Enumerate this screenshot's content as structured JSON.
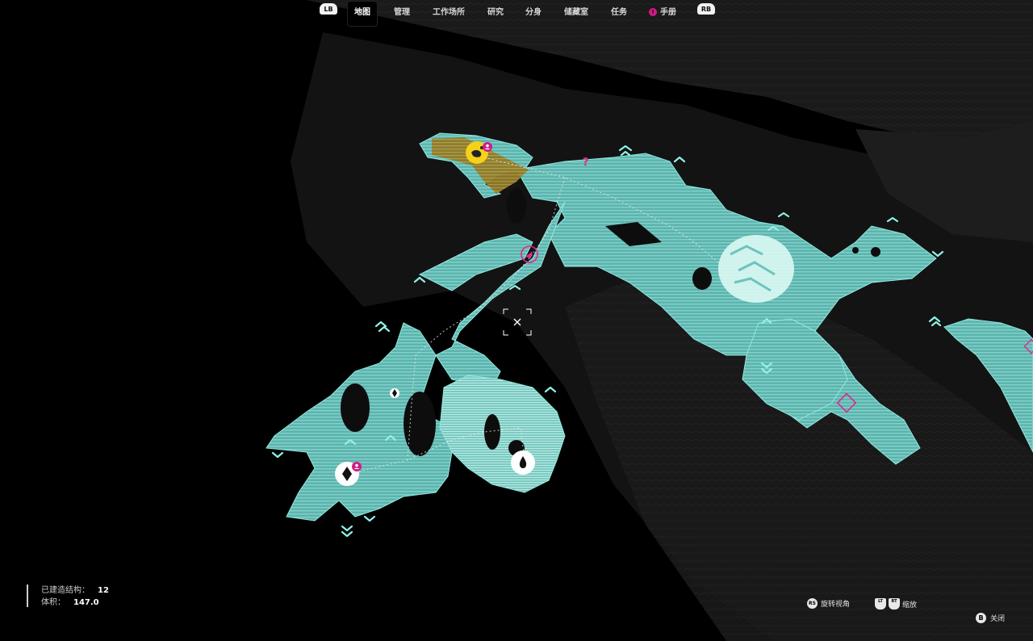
{
  "nav": {
    "left_button": "LB",
    "right_button": "RB",
    "tabs": [
      {
        "label": "地图",
        "active": true
      },
      {
        "label": "管理",
        "active": false
      },
      {
        "label": "工作场所",
        "active": false
      },
      {
        "label": "研究",
        "active": false
      },
      {
        "label": "分身",
        "active": false
      },
      {
        "label": "储藏室",
        "active": false
      },
      {
        "label": "任务",
        "active": false
      },
      {
        "label": "手册",
        "active": false
      }
    ],
    "handbook_badge": "!"
  },
  "stats": {
    "structures_label": "已建造结构：",
    "structures_value": "12",
    "volume_label": "体积：",
    "volume_value": "147.0"
  },
  "controls": {
    "rotate_button": "RS",
    "rotate_label": "旋转视角",
    "zoom_button_left": "LT",
    "zoom_button_right": "RT",
    "zoom_label": "缩放",
    "close_button": "B",
    "close_label": "关闭"
  },
  "map": {
    "colors": {
      "region": "#6fc3bd",
      "region_dark": "#3f8883",
      "highlight_zone": "#b69b3a",
      "player_marker": "#f5d11a",
      "poi_magenta": "#e0278f",
      "chevron": "#8ff3e8",
      "base_circle": "#d9f7f2"
    },
    "icons": [
      "player-marker-icon",
      "question-mark-icon",
      "target-marker-icon",
      "water-drop-icon",
      "resource-diamond-icon",
      "crosshair-icon",
      "base-marker-icon",
      "chevron-up-icon"
    ],
    "question_mark": "?"
  }
}
